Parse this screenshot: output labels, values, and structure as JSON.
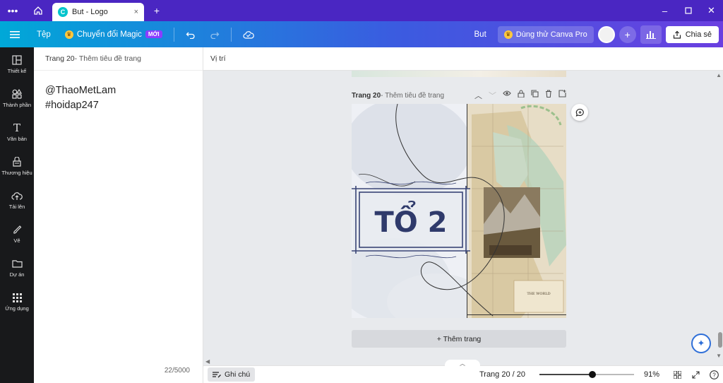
{
  "titlebar": {
    "menu_icon": "ellipsis-icon",
    "home_icon": "home-icon",
    "tab_title": "But - Logo",
    "tab_close": "×",
    "new_tab": "+",
    "window_controls": [
      "minimize",
      "maximize",
      "close"
    ]
  },
  "toolbar": {
    "file_label": "Tệp",
    "magic_label": "Chuyển đổi Magic",
    "magic_badge": "MỚI",
    "doc_name": "But",
    "pro_label": "Dùng thử Canva Pro",
    "share_label": "Chia sẻ"
  },
  "leftnav": {
    "items": [
      {
        "label": "Thiết kế",
        "icon": "layout-icon"
      },
      {
        "label": "Thành phần",
        "icon": "shapes-icon"
      },
      {
        "label": "Văn bản",
        "icon": "text-icon"
      },
      {
        "label": "Thương hiệu",
        "icon": "brand-icon"
      },
      {
        "label": "Tải lên",
        "icon": "upload-icon"
      },
      {
        "label": "Vẽ",
        "icon": "draw-icon"
      },
      {
        "label": "Dự án",
        "icon": "folder-icon"
      },
      {
        "label": "Ứng dụng",
        "icon": "apps-icon"
      }
    ]
  },
  "notes": {
    "header_page": "Trang 20",
    "header_title": " - Thêm tiêu đề trang",
    "line1": "@ThaoMetLam",
    "line2": "#hoidap247",
    "count": "22/5000"
  },
  "canvas": {
    "head_label": "Vị trí",
    "page_label": "Trang 20",
    "page_title": " - Thêm tiêu đề trang",
    "design_text": "TỔ 2",
    "map_caption": "THE WORLD",
    "add_page": "+ Thêm trang"
  },
  "bottombar": {
    "notes_label": "Ghi chú",
    "page_counter": "Trang 20 / 20",
    "zoom": "91%",
    "zoom_fraction": 0.56
  },
  "colors": {
    "titlebar": "#4a26c2",
    "text_dark_blue": "#2f3a6b",
    "accent": "#8b3dff"
  }
}
